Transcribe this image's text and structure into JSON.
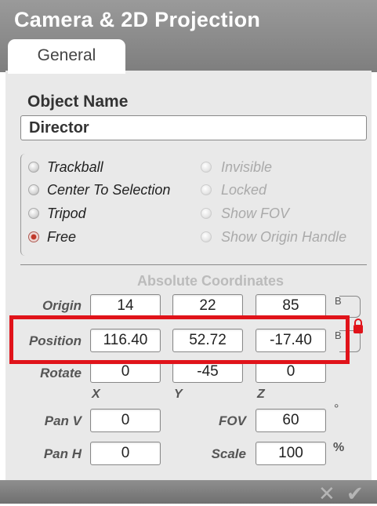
{
  "window": {
    "title": "Camera & 2D Projection"
  },
  "tabs": [
    {
      "label": "General"
    }
  ],
  "object": {
    "label": "Object Name",
    "value": "Director"
  },
  "mode_radios": [
    {
      "label": "Trackball",
      "selected": false
    },
    {
      "label": "Center To Selection",
      "selected": false
    },
    {
      "label": "Tripod",
      "selected": false
    },
    {
      "label": "Free",
      "selected": true
    }
  ],
  "options": [
    {
      "label": "Invisible"
    },
    {
      "label": "Locked"
    },
    {
      "label": "Show FOV"
    },
    {
      "label": "Show Origin Handle"
    }
  ],
  "coords": {
    "section_title": "Absolute Coordinates",
    "rows": [
      {
        "label": "Origin",
        "values": [
          "14",
          "22",
          "85"
        ]
      },
      {
        "label": "Position",
        "values": [
          "116.40",
          "52.72",
          "-17.40"
        ]
      },
      {
        "label": "Rotate",
        "values": [
          "0",
          "-45",
          "0"
        ]
      }
    ],
    "axes": [
      "X",
      "Y",
      "Z"
    ],
    "bracket_label": "B"
  },
  "camera": {
    "pan_v": {
      "label": "Pan V",
      "value": "0"
    },
    "pan_h": {
      "label": "Pan H",
      "value": "0"
    },
    "fov": {
      "label": "FOV",
      "value": "60",
      "unit": "°"
    },
    "scale": {
      "label": "Scale",
      "value": "100",
      "unit": "%"
    }
  },
  "footer": {
    "cancel_icon": "close-icon",
    "ok_icon": "check-icon"
  },
  "colors": {
    "header": "#8a8a8a",
    "highlight": "#e0131a",
    "radio_selected": "#c0392b"
  }
}
